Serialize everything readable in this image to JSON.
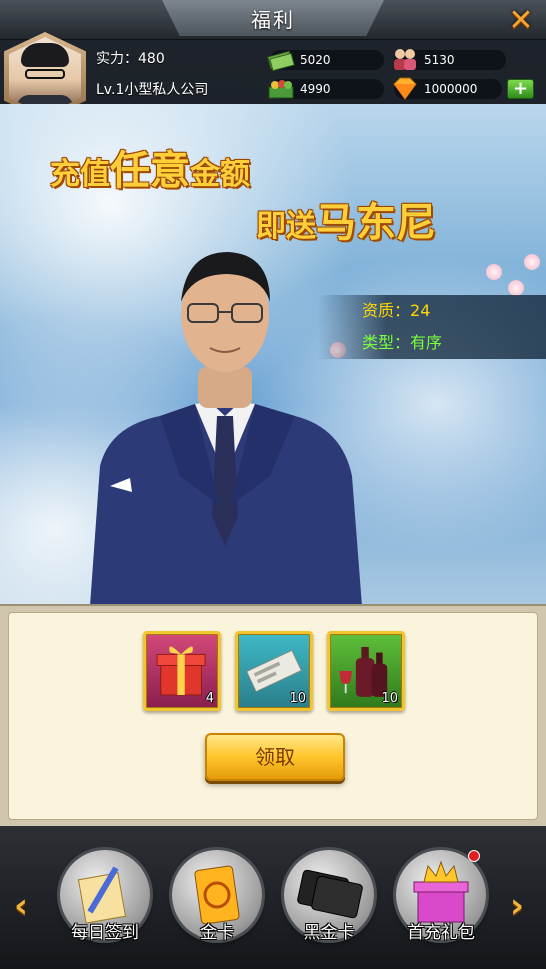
{
  "header": {
    "title": "福利",
    "close_icon": "close-x-icon"
  },
  "player": {
    "power_label": "实力：",
    "power_value": "480",
    "level_company": "Lv.1小型私人公司",
    "resources": {
      "cash": "5020",
      "staff": "5130",
      "goods": "4990",
      "diamonds": "1000000"
    }
  },
  "promo": {
    "line1_a": "充值",
    "line1_b": "任意",
    "line1_c": "金额",
    "line2_a": "即送",
    "line2_b": "马东尼"
  },
  "character": {
    "quality_label": "资质：",
    "quality_value": "24",
    "type_label": "类型：",
    "type_value": "有序"
  },
  "rewards": {
    "items": [
      {
        "icon": "gift-box-icon",
        "count": "4"
      },
      {
        "icon": "ticket-icon",
        "count": "10"
      },
      {
        "icon": "wine-bottles-icon",
        "count": "10"
      }
    ],
    "claim_label": "领取"
  },
  "nav": {
    "items": [
      {
        "label": "每日签到",
        "icon": "daily-signin-icon"
      },
      {
        "label": "金卡",
        "icon": "gold-card-icon"
      },
      {
        "label": "黑金卡",
        "icon": "black-card-icon"
      },
      {
        "label": "首充礼包",
        "icon": "first-recharge-gift-icon"
      }
    ]
  },
  "colors": {
    "accent_gold": "#ffcf3a",
    "quality_yellow": "#ffd700",
    "type_green": "#79ff3c",
    "button_orange": "#ffc52c"
  }
}
